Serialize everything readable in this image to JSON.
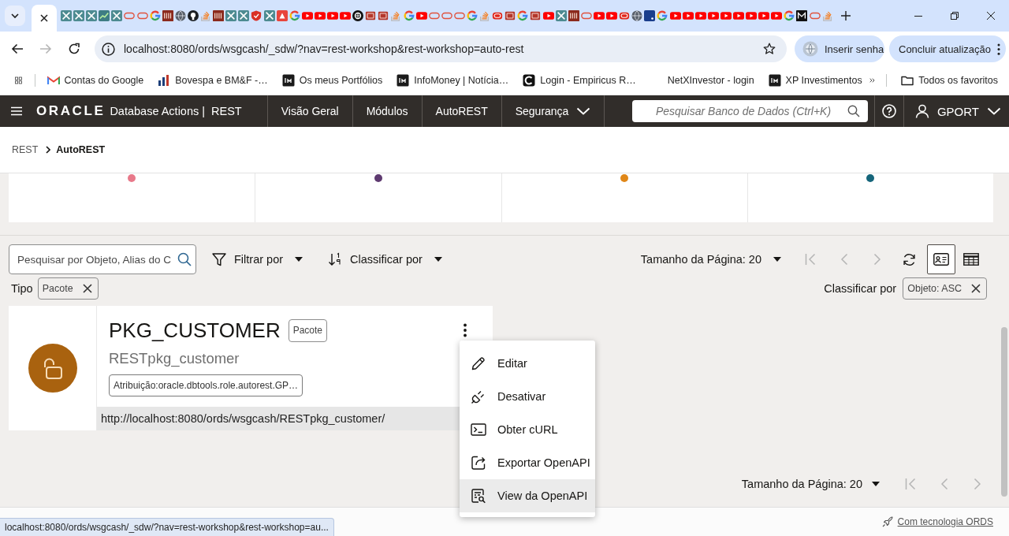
{
  "browser": {
    "url": "localhost:8080/ords/wsgcash/_sdw/?nav=rest-workshop&rest-workshop=auto-rest",
    "back_disabled": false,
    "forward_disabled": true,
    "password_button": "Inserir senha",
    "update_button": "Concluir atualização"
  },
  "bookmarks": [
    {
      "label": "Contas do Google",
      "kind": "mail"
    },
    {
      "label": "Bovespa e BM&F -…",
      "kind": "bars"
    },
    {
      "label": "Os meus Portfólios",
      "kind": "tile"
    },
    {
      "label": "InfoMoney | Notícia…",
      "kind": "tile"
    },
    {
      "label": "Login - Empiricus R…",
      "kind": "arc"
    },
    {
      "label": "NetXInvestor - login",
      "kind": "blank"
    },
    {
      "label": "XP Investimentos",
      "kind": "tile"
    }
  ],
  "all_bookmarks": "Todos os favoritos",
  "app_header": {
    "logo": "ORACLE",
    "product": "Database Actions |",
    "section": "REST",
    "nav": [
      {
        "label": "Visão Geral",
        "selected": false,
        "dropdown": false
      },
      {
        "label": "Módulos",
        "selected": false,
        "dropdown": false
      },
      {
        "label": "AutoREST",
        "selected": false,
        "dropdown": false
      },
      {
        "label": "Segurança",
        "selected": false,
        "dropdown": true
      }
    ],
    "search": {
      "placeholder": "Pesquisar Banco de Dados (Ctrl+K)"
    },
    "user": "GPORT"
  },
  "breadcrumb": [
    {
      "label": "REST",
      "current": false
    },
    {
      "label": "AutoREST",
      "current": true
    }
  ],
  "summary_panels": [
    {
      "color": "#e8798a"
    },
    {
      "color": "#5e3a70"
    },
    {
      "color": "#e08718"
    },
    {
      "color": "#15657a"
    }
  ],
  "toolbar": {
    "search": {
      "placeholder": "Pesquisar por Objeto, Alias do C"
    },
    "filter": "Filtrar por",
    "sort": "Classificar por",
    "page_size": "Tamanho da Página: 20",
    "paging_disabled": true,
    "views": [
      {
        "kind": "card",
        "selected": true
      },
      {
        "kind": "table",
        "selected": false
      }
    ]
  },
  "filters": {
    "label": "Tipo",
    "chips": [
      "Pacote"
    ]
  },
  "sorting": {
    "label": "Classificar por",
    "chips": [
      "Objeto: ASC"
    ]
  },
  "objects": [
    {
      "name": "PKG_CUSTOMER",
      "type": "Pacote",
      "alias": "RESTpkg_customer",
      "role": "Atribuição:oracle.dbtools.role.autorest.GP…",
      "url": "http://localhost:8080/ords/wsgcash/RESTpkg_customer/"
    }
  ],
  "context_menu": [
    {
      "label": "Editar",
      "kind": "edit",
      "selected": false
    },
    {
      "label": "Desativar",
      "kind": "disable",
      "selected": false
    },
    {
      "label": "Obter cURL",
      "kind": "curl",
      "selected": false
    },
    {
      "label": "Exportar OpenAPI",
      "kind": "export",
      "selected": false
    },
    {
      "label": "View da OpenAPI",
      "kind": "view",
      "selected": true
    }
  ],
  "pager": {
    "page_size": "Tamanho da Página: 20",
    "paging_disabled": true
  },
  "status_bar": {
    "powered_by": "Com tecnologia ORDS"
  },
  "link_preview": "localhost:8080/ords/wsgcash/_sdw/?nav=rest-workshop&rest-workshop=au..."
}
